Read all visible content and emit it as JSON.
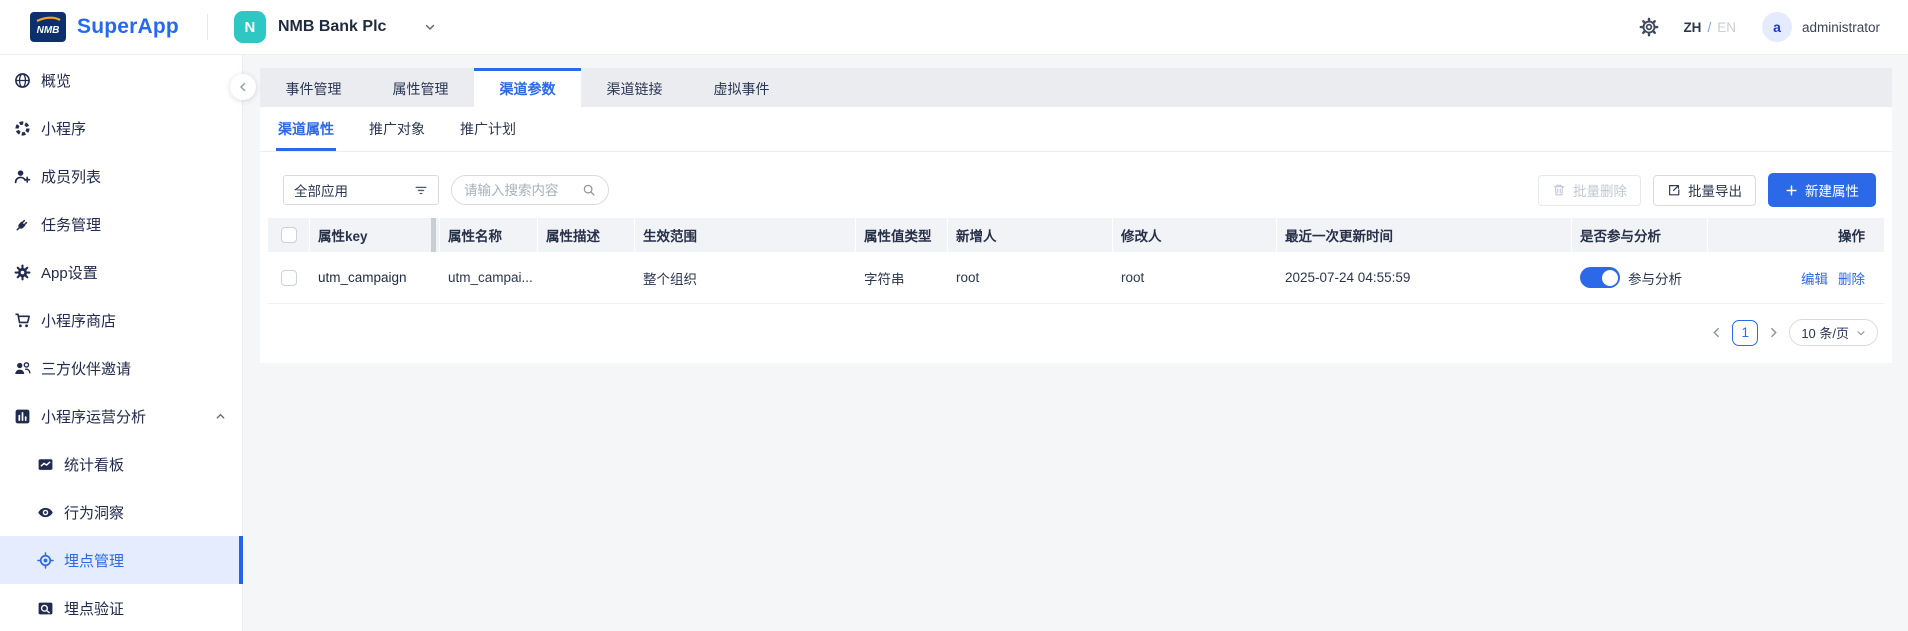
{
  "header": {
    "logo_text": "NMB",
    "app_name": "SuperApp",
    "org": {
      "initial": "N",
      "name": "NMB Bank Plc"
    },
    "language": {
      "zh": "ZH",
      "separator": "/",
      "en": "EN"
    },
    "user": {
      "initial": "a",
      "name": "administrator"
    }
  },
  "sidebar": {
    "items": [
      {
        "label": "概览",
        "icon": "globe-icon"
      },
      {
        "label": "小程序",
        "icon": "miniprogram-icon"
      },
      {
        "label": "成员列表",
        "icon": "member-add-icon"
      },
      {
        "label": "任务管理",
        "icon": "task-plug-icon"
      },
      {
        "label": "App设置",
        "icon": "settings-gear-icon"
      },
      {
        "label": "小程序商店",
        "icon": "store-cart-icon"
      },
      {
        "label": "三方伙伴邀请",
        "icon": "partners-icon"
      },
      {
        "label": "小程序运营分析",
        "icon": "analytics-bars-icon",
        "expanded": true
      },
      {
        "label": "统计看板",
        "icon": "dashboard-chart-icon",
        "sub": true
      },
      {
        "label": "行为洞察",
        "icon": "eye-icon",
        "sub": true
      },
      {
        "label": "埋点管理",
        "icon": "tracking-point-icon",
        "sub": true,
        "active": true
      },
      {
        "label": "埋点验证",
        "icon": "tracking-verify-icon",
        "sub": true
      }
    ]
  },
  "tabs": [
    "事件管理",
    "属性管理",
    "渠道参数",
    "渠道链接",
    "虚拟事件"
  ],
  "active_tab": "渠道参数",
  "subtabs": [
    "渠道属性",
    "推广对象",
    "推广计划"
  ],
  "active_subtab": "渠道属性",
  "toolbar": {
    "app_filter_value": "全部应用",
    "search_placeholder": "请输入搜索内容",
    "batch_delete_label": "批量删除",
    "batch_export_label": "批量导出",
    "new_attribute_label": "新建属性"
  },
  "table": {
    "headers": [
      "属性key",
      "属性名称",
      "属性描述",
      "生效范围",
      "属性值类型",
      "新增人",
      "修改人",
      "最近一次更新时间",
      "是否参与分析",
      "操作"
    ],
    "rows": [
      {
        "key": "utm_campaign",
        "name": "utm_campai...",
        "description": "",
        "scope": "整个组织",
        "value_type": "字符串",
        "creator": "root",
        "modifier": "root",
        "updated_at": "2025-07-24 04:55:59",
        "analysis_on": true,
        "analysis_label": "参与分析",
        "edit_label": "编辑",
        "delete_label": "删除"
      }
    ]
  },
  "pagination": {
    "current_page": "1",
    "page_size_label": "10 条/页"
  },
  "colors": {
    "accent_blue": "#2b69e8",
    "brand_blue": "#2469f0",
    "brand_navy": "#0d2f6e",
    "brand_orange": "#f6a21d",
    "org_teal": "#2fc7c3",
    "sidebar_active_bg": "#e4ecfd",
    "page_bg": "#f5f6f8",
    "tabstrip_bg": "#eaecf0",
    "table_header_bg": "#f2f3f6",
    "disabled_text": "#c1c8d2"
  }
}
